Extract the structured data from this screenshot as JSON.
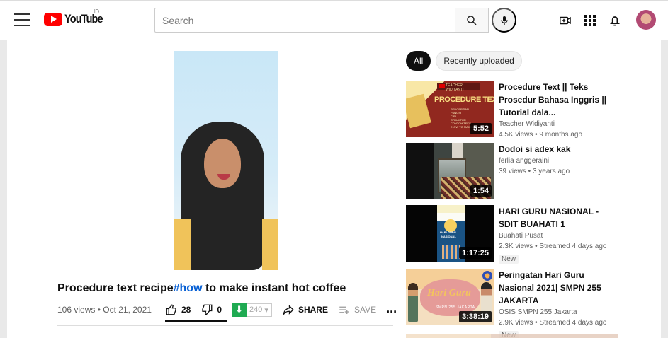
{
  "header": {
    "logo_text": "YouTube",
    "country_code": "ID",
    "search": {
      "placeholder": "Search",
      "value": ""
    },
    "icons": [
      "menu-icon",
      "search-icon",
      "microphone-icon",
      "create-video-icon",
      "apps-grid-icon",
      "notifications-icon",
      "avatar"
    ]
  },
  "player": {
    "title_prefix": "Procedure text recipe",
    "hashtag": "#how",
    "title_suffix": " to make instant hot coffee",
    "meta": "106 views • Oct 21, 2021",
    "actions": {
      "likes": "28",
      "dislikes": "0",
      "download_count": "240",
      "share": "SHARE",
      "save": "SAVE",
      "more": "..."
    }
  },
  "filters": [
    {
      "label": "All",
      "active": true
    },
    {
      "label": "Recently uploaded",
      "active": false
    }
  ],
  "recommendations": [
    {
      "title": "Procedure Text || Teks Prosedur Bahasa Inggris || Tutorial dala...",
      "channel": "Teacher Widiyanti",
      "stats": "4.5K views • 9 months ago",
      "duration": "5:52",
      "thumbnail_text": {
        "teacher": "TEACHER WIDIYANTI",
        "headline": "PROCEDURE TEXT",
        "lines": [
          "PENGERTIAN",
          "FUNGSI",
          "CIRI",
          "STRUKTUR",
          "CONTOH TEKS",
          "\"HOW TO MAKE FRENCH"
        ]
      }
    },
    {
      "title": "Dodoi si adex kak",
      "channel": "ferlia anggeraini",
      "stats": "39 views • 3 years ago",
      "duration": "1:54"
    },
    {
      "title": "HARI GURU NASIONAL - SDIT BUAHATI 1",
      "channel": "Buahati Pusat",
      "stats": "2.3K views • Streamed 4 days ago",
      "badge": "New",
      "duration": "1:17:25",
      "thumbnail_text": {
        "poster_line_1": "HARI GURU",
        "poster_line_2": "NASIONAL"
      }
    },
    {
      "title": "Peringatan Hari Guru Nasional 2021| SMPN 255 JAKARTA",
      "channel": "OSIS SMPN 255 Jakarta",
      "stats": "2.9K views • Streamed 4 days ago",
      "badge": "New",
      "duration": "3:38:19",
      "thumbnail_text": {
        "main": "Hari Guru",
        "sub": "SMPN 255 JAKARTA"
      }
    }
  ],
  "colors": {
    "youtube_red": "#ff0000",
    "hashtag_blue": "#065fd4",
    "download_green": "#1faa52",
    "muted_text": "#606060"
  }
}
